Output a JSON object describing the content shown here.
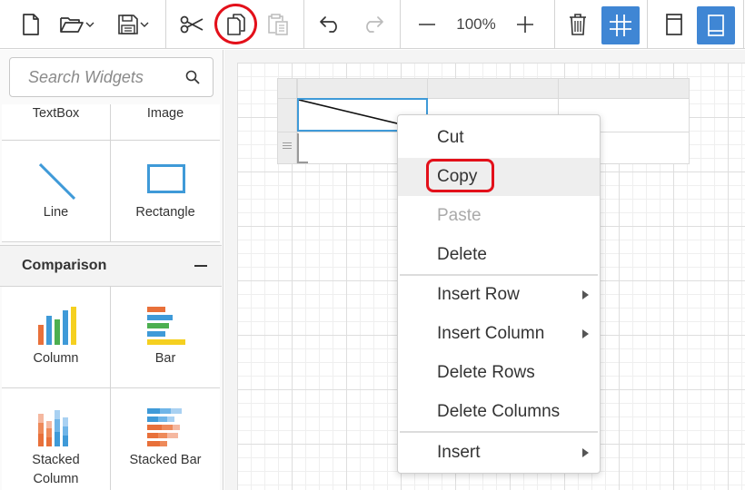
{
  "toolbar": {
    "zoom_label": "100%",
    "icons": [
      "new-file-icon",
      "open-folder-icon",
      "save-icon",
      "cut-icon",
      "copy-icon",
      "paste-icon",
      "undo-icon",
      "redo-icon",
      "zoom-out-icon",
      "zoom-in-icon",
      "delete-icon",
      "grid-icon",
      "header-footer-icon",
      "page-layout-icon"
    ],
    "active_color": "#3f86d4",
    "highlight_color": "#e3101a"
  },
  "panel": {
    "search_placeholder": "Search Widgets",
    "basic_items": [
      {
        "label": "TextBox"
      },
      {
        "label": "Image"
      },
      {
        "label": "Line"
      },
      {
        "label": "Rectangle"
      }
    ],
    "group": {
      "title": "Comparison",
      "items": [
        {
          "label": "Column"
        },
        {
          "label": "Bar"
        },
        {
          "label": "Stacked\nColumn"
        },
        {
          "label": "Stacked Bar"
        }
      ]
    }
  },
  "context_menu": {
    "items": [
      {
        "label": "Cut",
        "enabled": true
      },
      {
        "label": "Copy",
        "enabled": true,
        "hovered": true
      },
      {
        "label": "Paste",
        "enabled": false
      },
      {
        "label": "Delete",
        "enabled": true
      },
      {
        "label": "Insert Row",
        "enabled": true,
        "submenu": true
      },
      {
        "label": "Insert Column",
        "enabled": true,
        "submenu": true
      },
      {
        "label": "Delete Rows",
        "enabled": true
      },
      {
        "label": "Delete Columns",
        "enabled": true
      },
      {
        "label": "Insert",
        "enabled": true,
        "submenu": true
      }
    ]
  }
}
